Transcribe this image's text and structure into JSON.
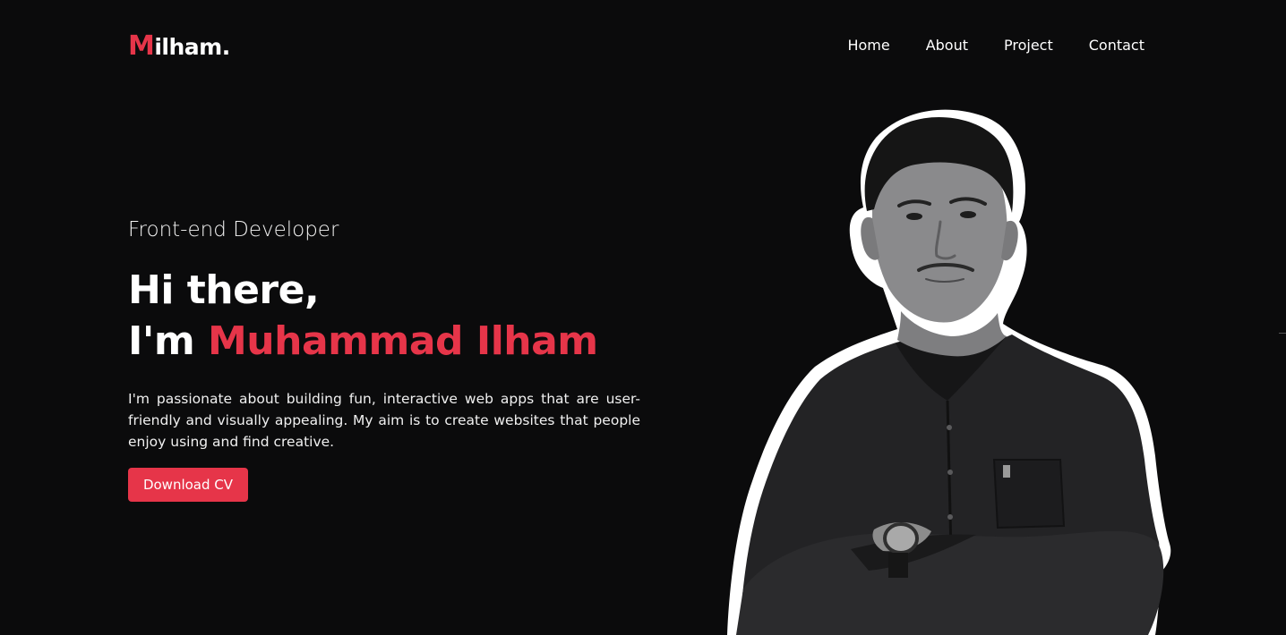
{
  "header": {
    "logo_accent": "M",
    "logo_rest": "ilham.",
    "nav": [
      {
        "label": "Home"
      },
      {
        "label": "About"
      },
      {
        "label": "Project"
      },
      {
        "label": "Contact"
      }
    ]
  },
  "hero": {
    "role": "Front-end Developer",
    "greeting": "Hi there,",
    "intro_prefix": "I'm ",
    "name": "Muhammad Ilham",
    "bio": "I'm passionate about building fun, interactive web apps that are user-friendly and visually appealing. My aim is to create websites that people enjoy using and find creative.",
    "cta_label": "Download CV"
  },
  "colors": {
    "background": "#0b0b0c",
    "accent": "#e63549",
    "text": "#ffffff"
  }
}
